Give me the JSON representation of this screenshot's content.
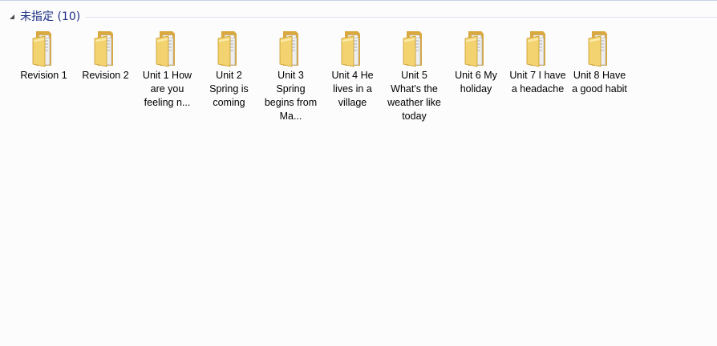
{
  "group": {
    "title": "未指定 (10)",
    "expanded": true,
    "chevron_icon": "expand-triangle-icon"
  },
  "folders": [
    {
      "label": "Revision 1"
    },
    {
      "label": "Revision 2"
    },
    {
      "label": "Unit 1 How are you feeling n..."
    },
    {
      "label": "Unit 2 Spring is coming"
    },
    {
      "label": "Unit 3 Spring begins from Ma..."
    },
    {
      "label": "Unit 4 He lives in a village"
    },
    {
      "label": "Unit 5 What's the weather like today"
    },
    {
      "label": "Unit 6 My holiday"
    },
    {
      "label": "Unit 7 I have a headache"
    },
    {
      "label": "Unit 8 Have a good habit"
    }
  ],
  "icon": "folder-with-documents-icon",
  "colors": {
    "background": "#fcfcfc",
    "group_title": "#1e3287",
    "folder_front": "#f2d36f",
    "folder_back": "#dcae43"
  }
}
